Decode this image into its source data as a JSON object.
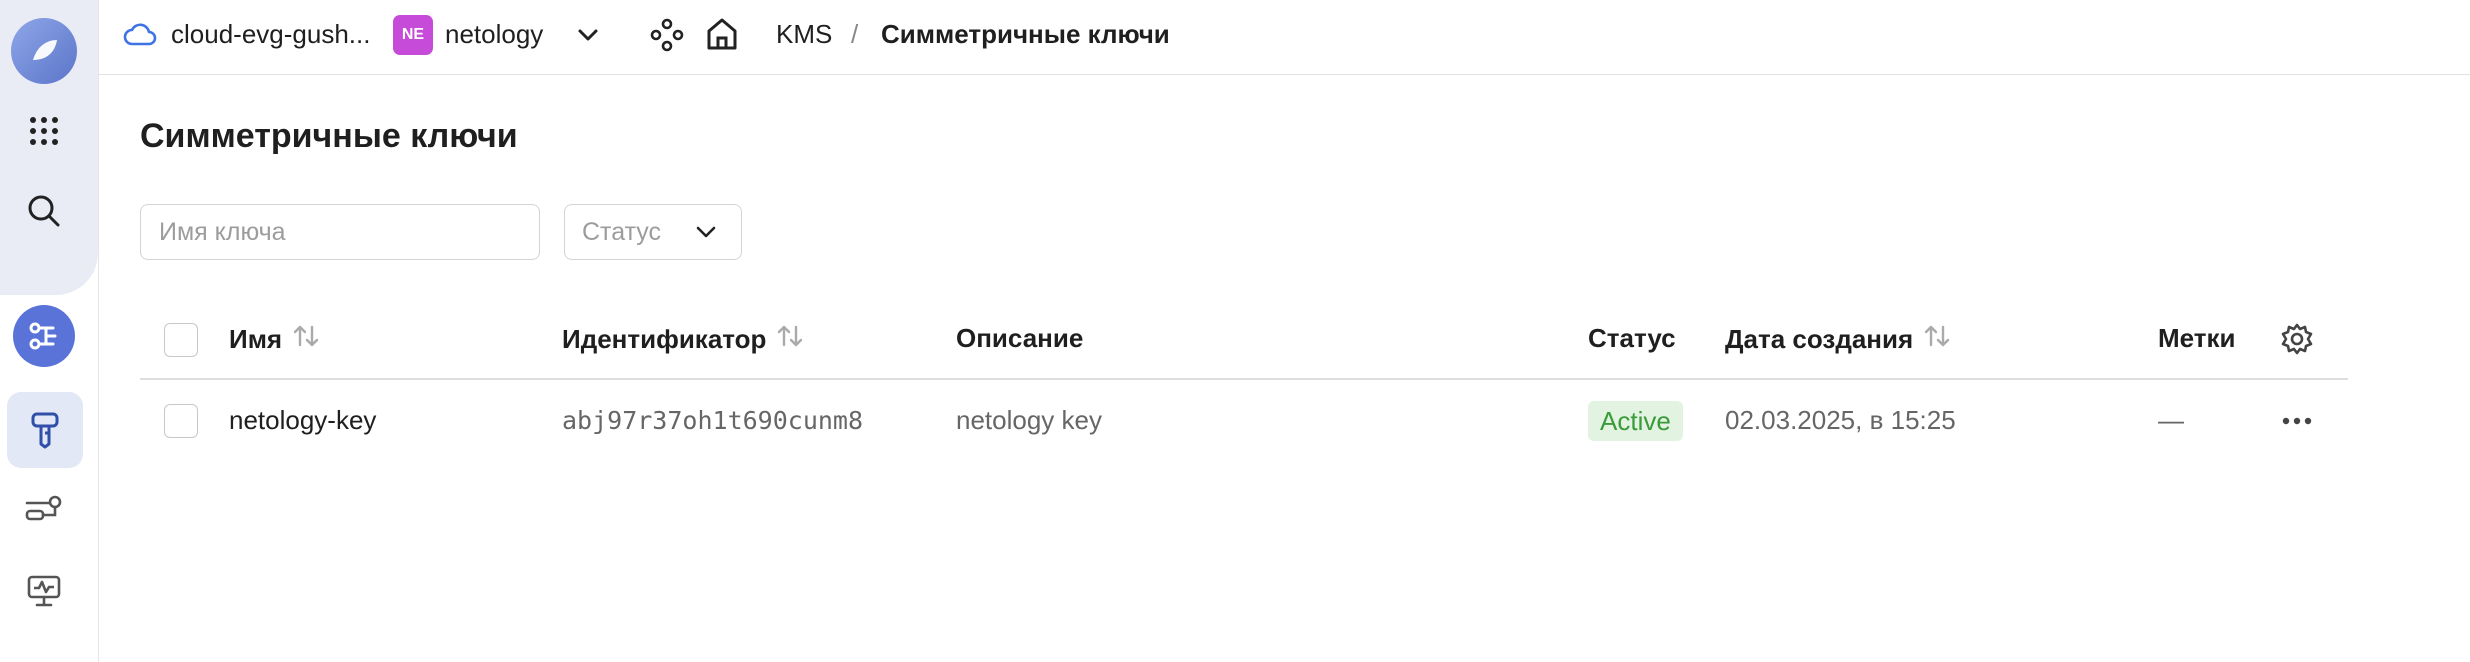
{
  "topbar": {
    "cloud_name": "cloud-evg-gush...",
    "org_badge": "NE",
    "org_name": "netology",
    "breadcrumb_service": "KMS",
    "breadcrumb_sep": "/",
    "breadcrumb_current": "Симметричные ключи"
  },
  "page": {
    "title": "Симметричные ключи",
    "search_placeholder": "Имя ключа",
    "status_placeholder": "Статус"
  },
  "table": {
    "columns": {
      "name": "Имя",
      "id": "Идентификатор",
      "description": "Описание",
      "status": "Статус",
      "created": "Дата создания",
      "labels": "Метки"
    },
    "rows": [
      {
        "name": "netology-key",
        "id": "abj97r37oh1t690cunm8",
        "description": "netology key",
        "status": "Active",
        "created": "02.03.2025, в 15:25",
        "labels": "—"
      }
    ]
  },
  "colors": {
    "accent": "#5a73d8",
    "status_active_bg": "#e3f3e1",
    "status_active_text": "#3a9b3a",
    "org_badge": "#c64bd8"
  },
  "icons": [
    "logo-icon",
    "apps-grid-icon",
    "search-icon",
    "services-icon",
    "kms-key-icon",
    "keys-icon",
    "monitoring-icon",
    "cloud-icon",
    "chevron-down-icon",
    "graph-icon",
    "home-icon",
    "sort-icon",
    "gear-icon",
    "more-icon"
  ]
}
